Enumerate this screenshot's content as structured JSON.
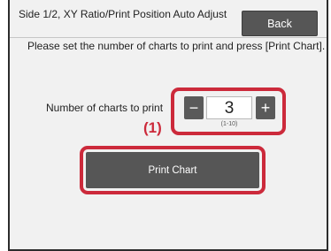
{
  "header": {
    "title": "Side 1/2, XY Ratio/Print Position Auto Adjust",
    "back_label": "Back"
  },
  "instruction": "Please set the number of charts to print and press [Print Chart].",
  "chart_count": {
    "label": "Number of charts to print",
    "minus_label": "−",
    "value": "3",
    "plus_label": "+",
    "range": "(1-10)"
  },
  "callout_label": "(1)",
  "print_button_label": "Print Chart",
  "colors": {
    "highlight": "#cc2a3b",
    "button": "#565656",
    "background": "#f1f1f1"
  }
}
